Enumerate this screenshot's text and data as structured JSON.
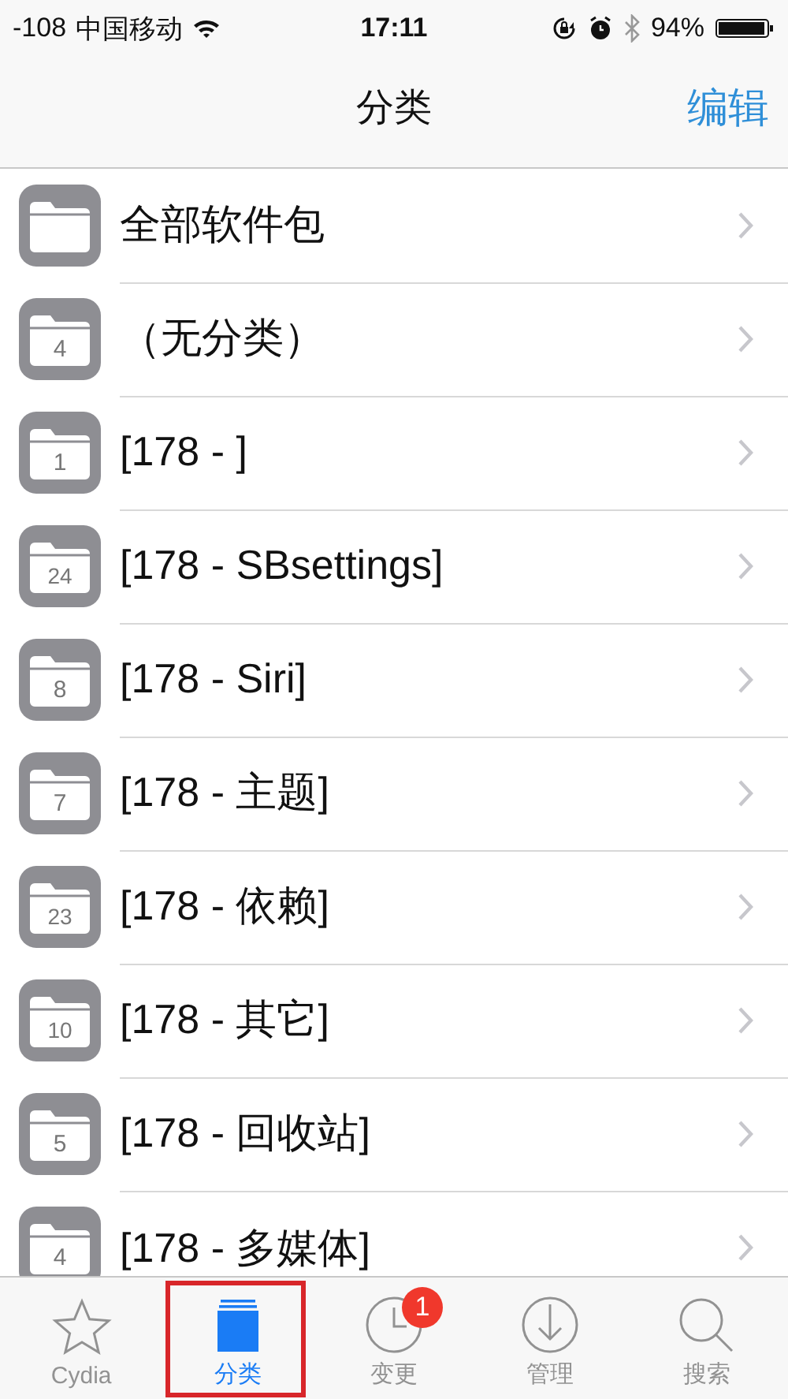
{
  "status_bar": {
    "signal": "-108",
    "carrier": "中国移动",
    "time": "17:11",
    "battery": "94%"
  },
  "nav_bar": {
    "title": "分类",
    "action": "编辑"
  },
  "categories": [
    {
      "label": "全部软件包"
    },
    {
      "label": "（无分类）",
      "count": "4"
    },
    {
      "label": "[178 - ]",
      "count": "1"
    },
    {
      "label": "[178 - SBsettings]",
      "count": "24"
    },
    {
      "label": "[178 - Siri]",
      "count": "8"
    },
    {
      "label": "[178 - 主题]",
      "count": "7"
    },
    {
      "label": "[178 - 依赖]",
      "count": "23"
    },
    {
      "label": "[178 - 其它]",
      "count": "10"
    },
    {
      "label": "[178 - 回收站]",
      "count": "5"
    },
    {
      "label": "[178 - 多媒体]",
      "count": "4"
    }
  ],
  "tab_bar": [
    {
      "kind": "star",
      "label": "Cydia",
      "selected": false
    },
    {
      "kind": "sections",
      "label": "分类",
      "selected": true,
      "highlighted": true
    },
    {
      "kind": "clock",
      "label": "变更",
      "selected": false,
      "badge": "1"
    },
    {
      "kind": "download",
      "label": "管理",
      "selected": false
    },
    {
      "kind": "search",
      "label": "搜索",
      "selected": false
    }
  ]
}
